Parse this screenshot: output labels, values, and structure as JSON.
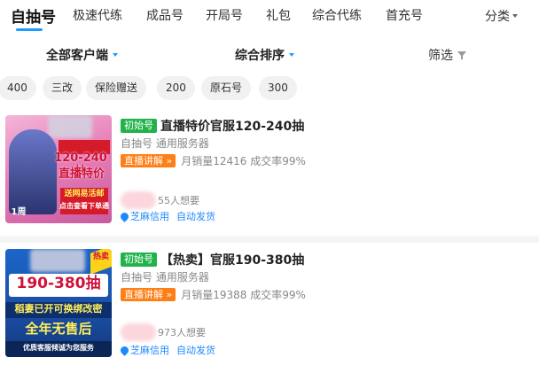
{
  "tabs": [
    {
      "label": "自抽号",
      "active": true
    },
    {
      "label": "极速代练"
    },
    {
      "label": "成品号"
    },
    {
      "label": "开局号"
    },
    {
      "label": "礼包"
    },
    {
      "label": "综合代练"
    },
    {
      "label": "首充号"
    }
  ],
  "category_label": "分类",
  "filters": {
    "client": "全部客户端",
    "sort": "综合排序",
    "filter": "筛选"
  },
  "chips": [
    "400",
    "三改",
    "保险赠送",
    "200",
    "原石号",
    "300"
  ],
  "accent": "#1e9bff",
  "listings": [
    {
      "tag": "初始号",
      "title": "直播特价官服120-240抽",
      "subtitle": "自抽号 通用服务器",
      "live_tag": "直播讲解 »",
      "sales": "月销量12416 成交率99%",
      "want": "55人想要",
      "service_credit": "芝麻信用",
      "service_auto": "自动发货",
      "thumb": {
        "line1": "120-240抽",
        "line2": "直播特价",
        "line3": "送网易活邮",
        "line4": "点击查看下单通",
        "corner": "1周"
      }
    },
    {
      "tag": "初始号",
      "title": "【热卖】官服190-380抽",
      "subtitle": "自抽号 通用服务器",
      "live_tag": "直播讲解 »",
      "sales": "月销量19388 成交率99%",
      "want": "973人想要",
      "service_credit": "芝麻信用",
      "service_auto": "自动发货",
      "thumb": {
        "line1": "190-380抽",
        "line2": "稻妻已开可换绑改密",
        "line3": "全年无售后",
        "line4": "优质客服倾诚为您服务",
        "corner": "热卖"
      }
    }
  ]
}
